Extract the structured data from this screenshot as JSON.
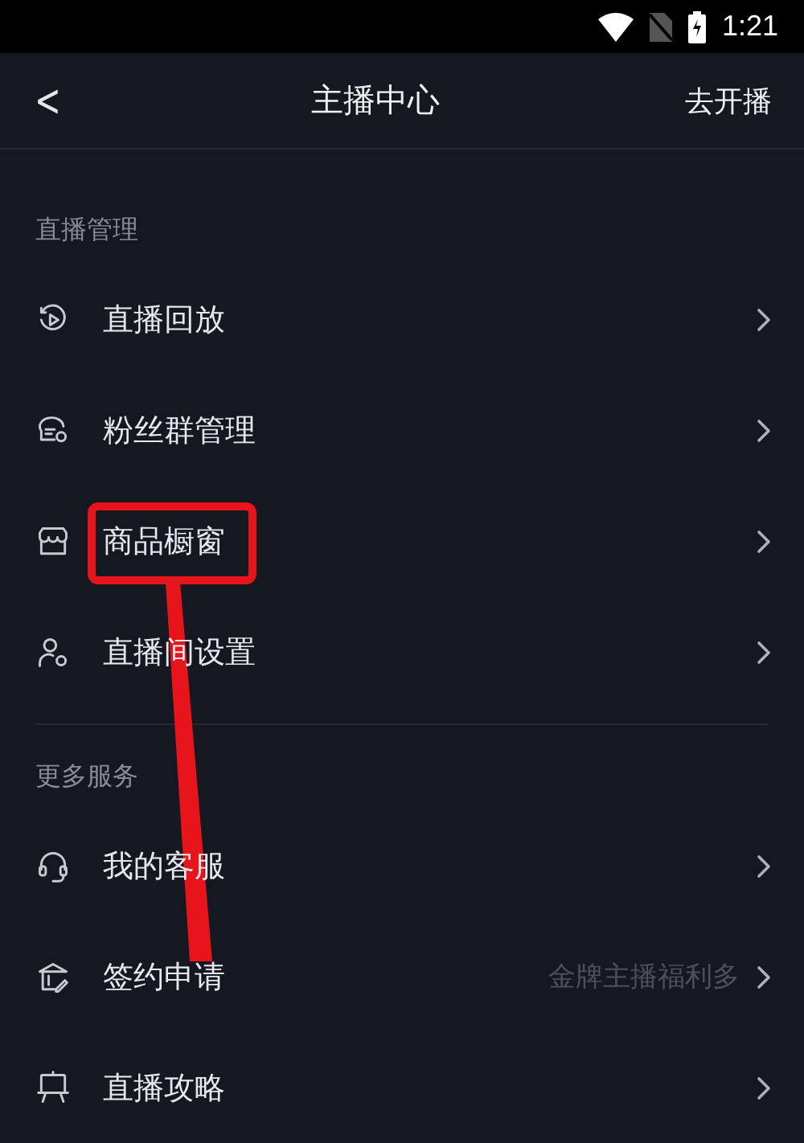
{
  "status_bar": {
    "time": "1:21"
  },
  "nav": {
    "back": "<",
    "title": "主播中心",
    "action": "去开播"
  },
  "sections": [
    {
      "title": "直播管理",
      "items": [
        {
          "label": "直播回放"
        },
        {
          "label": "粉丝群管理"
        },
        {
          "label": "商品橱窗"
        },
        {
          "label": "直播间设置"
        }
      ]
    },
    {
      "title": "更多服务",
      "items": [
        {
          "label": "我的客服"
        },
        {
          "label": "签约申请",
          "hint": "金牌主播福利多"
        },
        {
          "label": "直播攻略"
        }
      ]
    }
  ]
}
